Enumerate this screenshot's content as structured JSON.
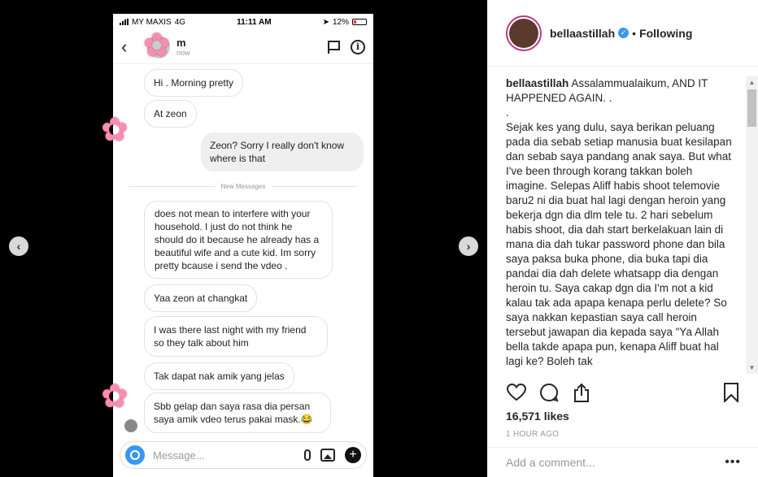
{
  "phone": {
    "status": {
      "carrier": "MY MAXIS",
      "network": "4G",
      "time": "11:11 AM",
      "battery": "12%"
    },
    "header": {
      "name": "m",
      "status": "now"
    },
    "messages": [
      {
        "dir": "in",
        "text": "Hi . Morning pretty"
      },
      {
        "dir": "in",
        "text": "At zeon"
      },
      {
        "dir": "out",
        "text": "Zeon? Sorry I really don't know where is that"
      },
      {
        "dir": "in",
        "text": "does not mean to interfere with your household. I just do not think he should do it because he already has a beautiful wife and a cute kid. Im sorry pretty bcause i send the vdeo ."
      },
      {
        "dir": "in",
        "text": "Yaa zeon at changkat"
      },
      {
        "dir": "in",
        "text": "I was there last night with my friend so they talk about him"
      },
      {
        "dir": "in",
        "text": "Tak dapat nak amik yang jelas"
      },
      {
        "dir": "in",
        "text": "Sbb gelap dan saya rasa dia persan saya amik vdeo terus pakai mask.😂"
      }
    ],
    "divider": "New Messages",
    "composer_placeholder": "Message..."
  },
  "post": {
    "username": "bellaastillah",
    "follow_state": "Following",
    "caption_text": "Assalammualaikum, AND IT HAPPENED AGAIN. .",
    "caption_dot": ".",
    "caption_body": "Sejak kes yang dulu, saya berikan peluang pada dia sebab setiap manusia buat kesilapan dan sebab saya pandang anak saya. But what I've been through korang takkan boleh imagine. Selepas Aliff habis shoot telemovie baru2 ni dia buat hal lagi dengan heroin yang bekerja dgn dia dlm tele tu. 2 hari sebelum habis shoot, dia dah start berkelakuan lain di mana dia dah tukar password phone dan bila saya paksa buka phone, dia buka tapi dia pandai dia dah delete whatsapp dia dengan heroin tu. Saya cakap dgn dia I'm not a kid kalau tak ada apapa kenapa perlu delete? So saya nakkan kepastian saya call heroin tersebut jawapan dia kepada saya \"Ya Allah bella takde apapa pun, kenapa Aliff buat hal lagi ke? Boleh tak",
    "likes": "16,571 likes",
    "time": "1 HOUR AGO",
    "comment_placeholder": "Add a comment...",
    "more": "•••"
  },
  "nav": {
    "prev": "‹",
    "next": "›"
  }
}
